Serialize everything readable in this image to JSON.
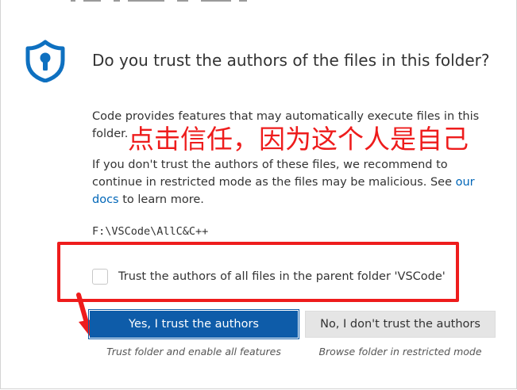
{
  "dialog": {
    "title": "Do you trust the authors of the files in this folder?",
    "message_part1": "Code provides features that may automatically execute files in this folder.",
    "message_part2_before_link": "If you don't trust the authors of these files, we recommend to continue in restricted mode as the files may be malicious. See ",
    "docs_link_label": "our docs",
    "message_part2_after_link": " to learn more.",
    "folder_path": "F:\\VSCode\\AllC&C++",
    "checkbox_label": "Trust the authors of all files in the parent folder 'VSCode'",
    "checkbox_checked": false,
    "primary_button_label": "Yes, I trust the authors",
    "primary_button_caption": "Trust folder and enable all features",
    "secondary_button_label": "No, I don't trust the authors",
    "secondary_button_caption": "Browse folder in restricted mode"
  },
  "annotation": {
    "text": "点击信任，因为这个人是自己",
    "color": "#ee1c1c"
  },
  "colors": {
    "shield_icon": "#0e70c0",
    "primary_button": "#0e5ca9",
    "secondary_button": "#e5e5e5",
    "link": "#0066b8"
  },
  "icons": {
    "trust": "shield-keyhole-icon",
    "pointer": "red-arrow-icon"
  }
}
